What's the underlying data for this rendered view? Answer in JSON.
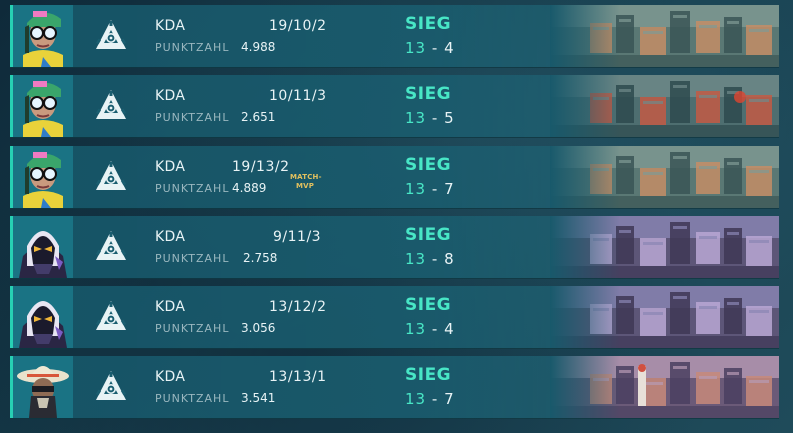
{
  "labels": {
    "kda": "KDA",
    "score": "PUNKTZAHL"
  },
  "colors": {
    "accent": "#27d0b4",
    "win": "#48e6c6",
    "mvp": "#e2c15e"
  },
  "matches": [
    {
      "agent_icon": "agent-glasses-portrait",
      "kda": "19/10/2",
      "score": "4.988",
      "mvp_label": "",
      "result": "SIEG",
      "team_score": "13",
      "dash": "-",
      "enemy_score": "4",
      "map_style": "warm"
    },
    {
      "agent_icon": "agent-glasses-portrait",
      "kda": "10/11/3",
      "score": "2.651",
      "mvp_label": "",
      "result": "SIEG",
      "team_score": "13",
      "dash": "-",
      "enemy_score": "5",
      "map_style": "warm-red"
    },
    {
      "agent_icon": "agent-glasses-portrait",
      "kda": "19/13/2",
      "score": "4.889",
      "mvp_label": "MATCH-MVP",
      "result": "SIEG",
      "team_score": "13",
      "dash": "-",
      "enemy_score": "7",
      "map_style": "warm"
    },
    {
      "agent_icon": "agent-hooded-portrait",
      "kda": "9/11/3",
      "score": "2.758",
      "mvp_label": "",
      "result": "SIEG",
      "team_score": "13",
      "dash": "-",
      "enemy_score": "8",
      "map_style": "purple"
    },
    {
      "agent_icon": "agent-hooded-portrait",
      "kda": "13/12/2",
      "score": "3.056",
      "mvp_label": "",
      "result": "SIEG",
      "team_score": "13",
      "dash": "-",
      "enemy_score": "4",
      "map_style": "purple"
    },
    {
      "agent_icon": "agent-hat-portrait",
      "kda": "13/13/1",
      "score": "3.541",
      "mvp_label": "",
      "result": "SIEG",
      "team_score": "13",
      "dash": "-",
      "enemy_score": "7",
      "map_style": "city"
    }
  ]
}
